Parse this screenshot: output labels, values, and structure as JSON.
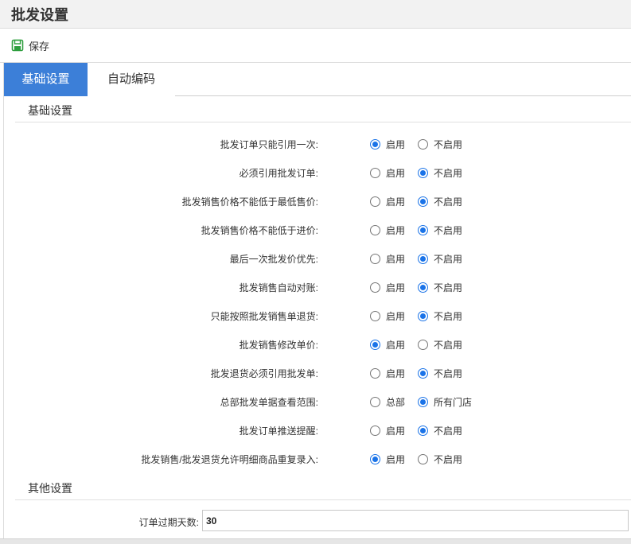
{
  "header": {
    "title": "批发设置"
  },
  "toolbar": {
    "save_label": "保存",
    "save_icon": "floppy-disk-icon",
    "save_color": "#2e9e3e"
  },
  "tabs": [
    {
      "label": "基础设置",
      "active": true
    },
    {
      "label": "自动编码",
      "active": false
    }
  ],
  "sections": {
    "basic": "基础设置",
    "other": "其他设置"
  },
  "settings": [
    {
      "label": "批发订单只能引用一次:",
      "options": [
        "启用",
        "不启用"
      ],
      "selected": 0
    },
    {
      "label": "必须引用批发订单:",
      "options": [
        "启用",
        "不启用"
      ],
      "selected": 1
    },
    {
      "label": "批发销售价格不能低于最低售价:",
      "options": [
        "启用",
        "不启用"
      ],
      "selected": 1
    },
    {
      "label": "批发销售价格不能低于进价:",
      "options": [
        "启用",
        "不启用"
      ],
      "selected": 1
    },
    {
      "label": "最后一次批发价优先:",
      "options": [
        "启用",
        "不启用"
      ],
      "selected": 1
    },
    {
      "label": "批发销售自动对账:",
      "options": [
        "启用",
        "不启用"
      ],
      "selected": 1
    },
    {
      "label": "只能按照批发销售单退货:",
      "options": [
        "启用",
        "不启用"
      ],
      "selected": 1
    },
    {
      "label": "批发销售修改单价:",
      "options": [
        "启用",
        "不启用"
      ],
      "selected": 0
    },
    {
      "label": "批发退货必须引用批发单:",
      "options": [
        "启用",
        "不启用"
      ],
      "selected": 1
    },
    {
      "label": "总部批发单据查看范围:",
      "options": [
        "总部",
        "所有门店"
      ],
      "selected": 1
    },
    {
      "label": "批发订单推送提醒:",
      "options": [
        "启用",
        "不启用"
      ],
      "selected": 1
    },
    {
      "label": "批发销售/批发退货允许明细商品重复录入:",
      "options": [
        "启用",
        "不启用"
      ],
      "selected": 0
    }
  ],
  "order_expiry": {
    "label": "订单过期天数:",
    "value": "30"
  },
  "colors": {
    "accent": "#3c7fd8",
    "radio": "#1a73e8"
  }
}
